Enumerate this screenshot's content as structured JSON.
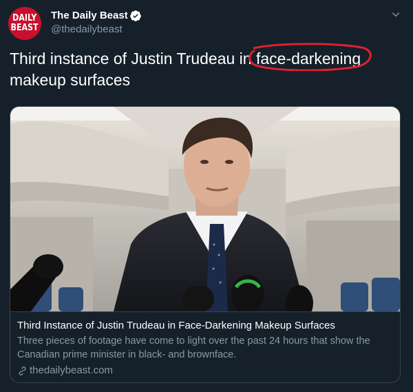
{
  "author": {
    "avatar_line1": "DAILY",
    "avatar_line2": "BEAST",
    "name": "The Daily Beast",
    "handle": "@thedailybeast",
    "verified": true
  },
  "tweet": {
    "text_before": "Third instance of Justin Trudeau in ",
    "text_highlight": "face-darkening",
    "text_after": " makeup surfaces",
    "highlight_color": "#e0212e"
  },
  "card": {
    "title": "Third Instance of Justin Trudeau in Face-Darkening Makeup Surfaces",
    "description": "Three pieces of footage have come to light over the past 24 hours that show the Canadian prime minister in black- and brownface.",
    "domain": "thedailybeast.com"
  },
  "icons": {
    "verified": "verified-badge-icon",
    "caret": "chevron-down-icon",
    "link": "link-icon"
  },
  "colors": {
    "background": "#15202b",
    "border": "#38444d",
    "secondary_text": "#8899a6",
    "avatar": "#c8102e"
  }
}
